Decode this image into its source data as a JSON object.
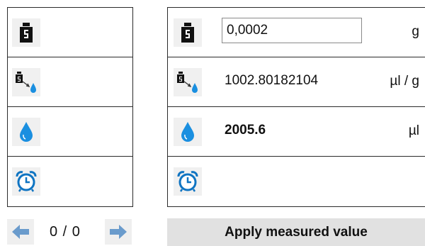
{
  "left_panel": {
    "rows": [
      {
        "icon": "weight-icon"
      },
      {
        "icon": "density-icon"
      },
      {
        "icon": "drop-icon"
      },
      {
        "icon": "alarm-clock-icon"
      }
    ]
  },
  "right_panel": {
    "weight": {
      "value": "0,0002",
      "unit": "g"
    },
    "density": {
      "value": "1002.80182104",
      "unit": "µl / g"
    },
    "volume": {
      "value": "2005.6",
      "unit": "µl"
    },
    "time": {
      "value": ""
    }
  },
  "navigation": {
    "prev_icon": "arrow-left-icon",
    "next_icon": "arrow-right-icon",
    "counter": "0 / 0"
  },
  "apply_button_label": "Apply measured value",
  "colors": {
    "drop": "#1a8fe0",
    "clock": "#0f74c2",
    "arrow": "#6a9bcc",
    "border": "#2b2b2b"
  }
}
